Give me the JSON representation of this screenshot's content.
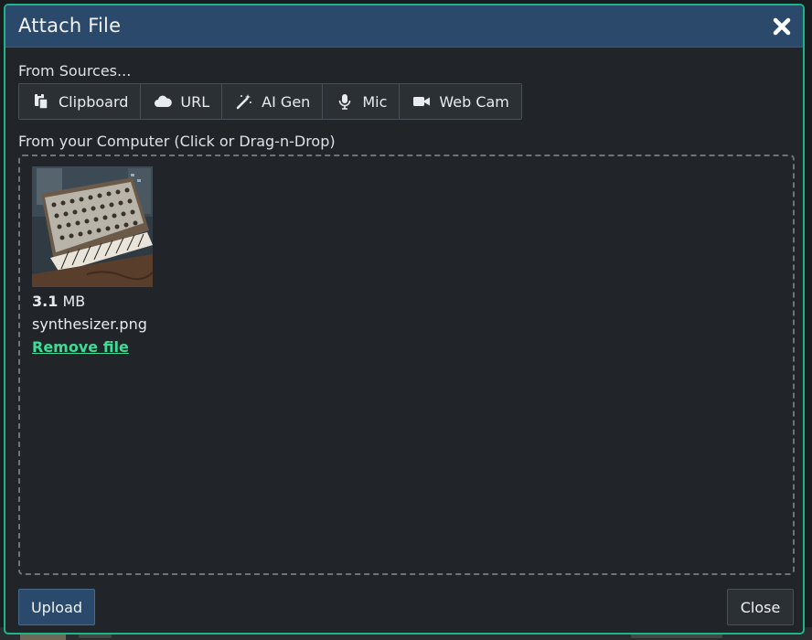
{
  "dialog": {
    "title": "Attach File"
  },
  "sources": {
    "label": "From Sources...",
    "buttons": [
      {
        "label": "Clipboard",
        "icon": "clipboard-icon"
      },
      {
        "label": "URL",
        "icon": "cloud-icon"
      },
      {
        "label": "AI Gen",
        "icon": "magic-wand-icon"
      },
      {
        "label": "Mic",
        "icon": "microphone-icon"
      },
      {
        "label": "Web Cam",
        "icon": "video-camera-icon"
      }
    ]
  },
  "computer": {
    "label": "From your Computer (Click or Drag-n-Drop)"
  },
  "file": {
    "size_value": "3.1",
    "size_unit": "MB",
    "name": "synthesizer.png",
    "remove_label": "Remove file"
  },
  "footer": {
    "upload_label": "Upload",
    "close_label": "Close"
  },
  "colors": {
    "accent_border": "#1fb38a",
    "header_bg": "#2b4a6b",
    "link": "#3ddc97"
  }
}
